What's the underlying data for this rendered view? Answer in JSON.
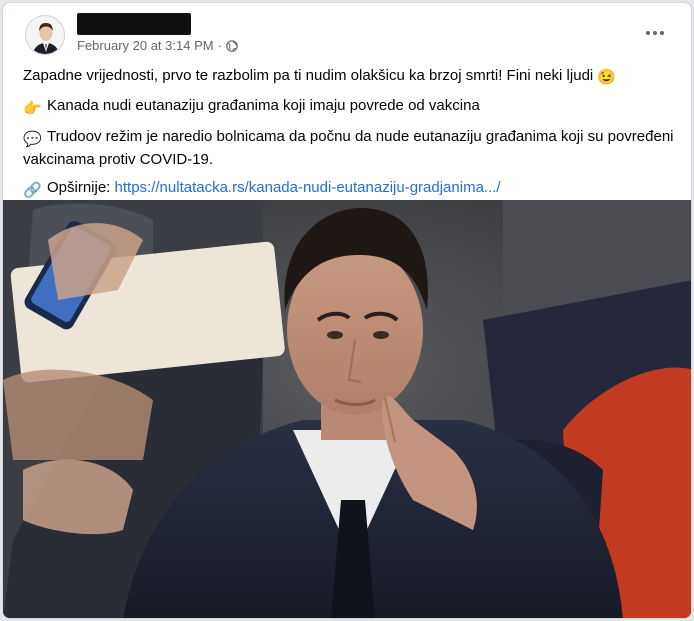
{
  "post": {
    "author_name": "",
    "timestamp": "February 20 at 3:14 PM",
    "separator": "·",
    "privacy_icon": "globe-icon",
    "more_icon": "more-horizontal-icon",
    "lines": {
      "line1": "Zapadne vrijednosti, prvo te razbolim pa ti nudim olakšicu ka brzoj smrti! Fini neki ljudi",
      "line1_emoji": "😉",
      "line2_icon": "👉",
      "line2": "Kanada nudi eutanaziju građanima koji imaju povrede od vakcina",
      "line3_icon": "💬",
      "line3": "Trudoov režim je naredio bolnicama da počnu da nude eutanaziju građanima koji su povređeni vakcinama protiv COVID-19.",
      "line4_icon": "🔗",
      "line4_label": "Opširnije:",
      "line4_link": "https://nultatacka.rs/kanada-nudi-eutanaziju-gradjanima.../"
    },
    "image_icon": "man-in-suit-photo"
  },
  "colors": {
    "link": "#216fdb",
    "meta": "#65676b",
    "text": "#050505"
  }
}
